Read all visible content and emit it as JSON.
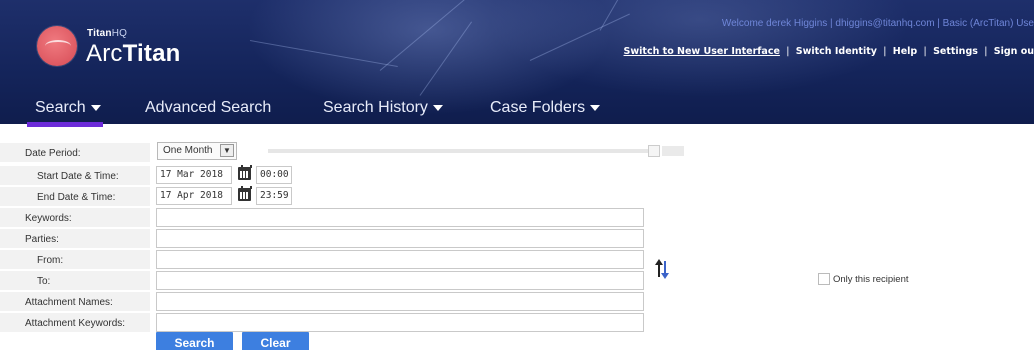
{
  "brand": {
    "company": "Titan",
    "company_suffix": "HQ",
    "product_prefix": "Arc",
    "product_bold": "Titan"
  },
  "header": {
    "welcome": "Welcome derek Higgins | dhiggins@titanhq.com | Basic (ArcTitan) Use",
    "links": [
      "Switch to New User Interface",
      "Switch Identity",
      "Help",
      "Settings",
      "Sign ou"
    ],
    "link_sep": "|"
  },
  "nav": {
    "items": [
      {
        "label": "Search",
        "dropdown": true,
        "active": true
      },
      {
        "label": "Advanced Search",
        "dropdown": false
      },
      {
        "label": "Search History",
        "dropdown": true
      },
      {
        "label": "Case Folders",
        "dropdown": true
      }
    ]
  },
  "form": {
    "date_period_label": "Date Period:",
    "date_period_value": "One Month",
    "start_label": "Start Date & Time:",
    "start_date": "17 Mar 2018",
    "start_time": "00:00",
    "end_label": "End Date & Time:",
    "end_date": "17 Apr 2018",
    "end_time": "23:59",
    "keywords_label": "Keywords:",
    "parties_label": "Parties:",
    "from_label": "From:",
    "to_label": "To:",
    "attachment_names_label": "Attachment Names:",
    "attachment_keywords_label": "Attachment Keywords:",
    "only_recipient_label": "Only this recipient"
  },
  "buttons": {
    "search": "Search",
    "clear": "Clear"
  },
  "colors": {
    "header_bg": "#17275f",
    "nav_active": "#6c2bd9",
    "button": "#3d7fe0",
    "logo": "#e05a63"
  }
}
